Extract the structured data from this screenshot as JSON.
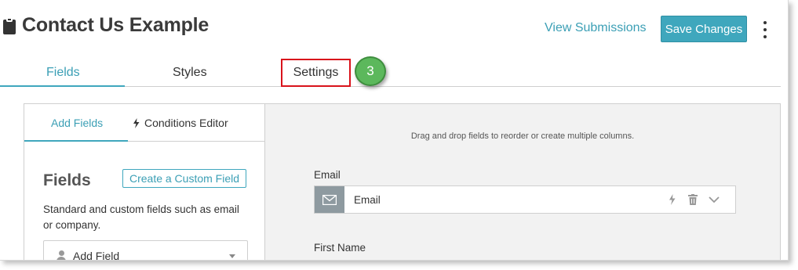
{
  "header": {
    "title": "Contact Us Example",
    "title_icon": "clipboard-icon",
    "view_submissions": "View Submissions",
    "save_button": "Save Changes",
    "more_icon": "kebab-menu-icon"
  },
  "tabs": [
    {
      "label": "Fields",
      "active": true
    },
    {
      "label": "Styles",
      "active": false
    },
    {
      "label": "Settings",
      "active": false,
      "highlighted": true
    }
  ],
  "step_badge": "3",
  "left_panel": {
    "sub_tabs": [
      {
        "label": "Add Fields",
        "active": true
      },
      {
        "label": "Conditions Editor",
        "icon": "bolt-icon",
        "active": false
      }
    ],
    "heading": "Fields",
    "create_custom_field": "Create a Custom Field",
    "description": "Standard and custom fields such as email or company.",
    "add_field_select": {
      "icon": "person-icon",
      "value": "Add Field"
    }
  },
  "right_panel": {
    "hint": "Drag and drop fields to reorder or create multiple columns.",
    "fields": [
      {
        "label": "Email",
        "icon": "envelope-icon",
        "value": "Email",
        "actions": [
          "bolt-icon",
          "trash-icon",
          "chevron-down-icon"
        ]
      },
      {
        "label": "First Name"
      }
    ]
  },
  "colors": {
    "accent": "#3fa7bd",
    "highlight_box": "#d9131b",
    "step_badge": "#5cb85c",
    "canvas_bg": "#f2f2f2"
  }
}
